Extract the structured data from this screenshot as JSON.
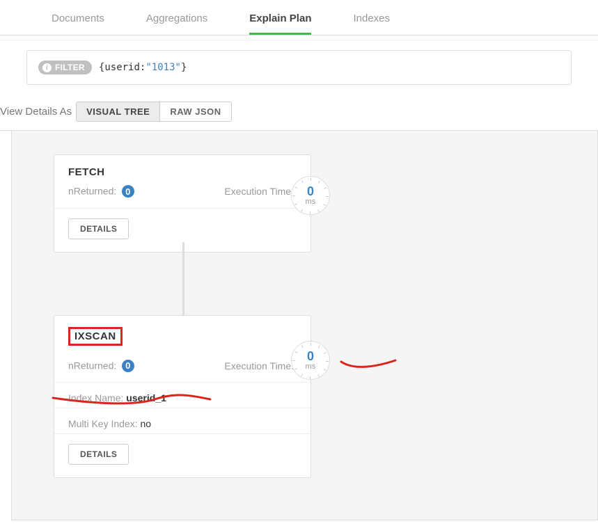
{
  "tabs": [
    {
      "label": "Documents",
      "active": false
    },
    {
      "label": "Aggregations",
      "active": false
    },
    {
      "label": "Explain Plan",
      "active": true
    },
    {
      "label": "Indexes",
      "active": false
    }
  ],
  "filter": {
    "badge_label": "FILTER",
    "query_key": "userid",
    "query_value": "\"1013\""
  },
  "view_toggle": {
    "label": "View Details As",
    "options": [
      {
        "label": "VISUAL TREE",
        "active": true
      },
      {
        "label": "RAW JSON",
        "active": false
      }
    ]
  },
  "stages": {
    "fetch": {
      "title": "FETCH",
      "nreturned_label": "nReturned:",
      "nreturned_value": "0",
      "exec_label": "Execution Time:",
      "exec_value": "0",
      "exec_unit": "ms",
      "details_label": "DETAILS"
    },
    "ixscan": {
      "title": "IXSCAN",
      "nreturned_label": "nReturned:",
      "nreturned_value": "0",
      "exec_label": "Execution Time:",
      "exec_value": "0",
      "exec_unit": "ms",
      "index_name_label": "Index Name:",
      "index_name_value": "userid_1",
      "multikey_label": "Multi Key Index:",
      "multikey_value": "no",
      "details_label": "DETAILS"
    }
  }
}
